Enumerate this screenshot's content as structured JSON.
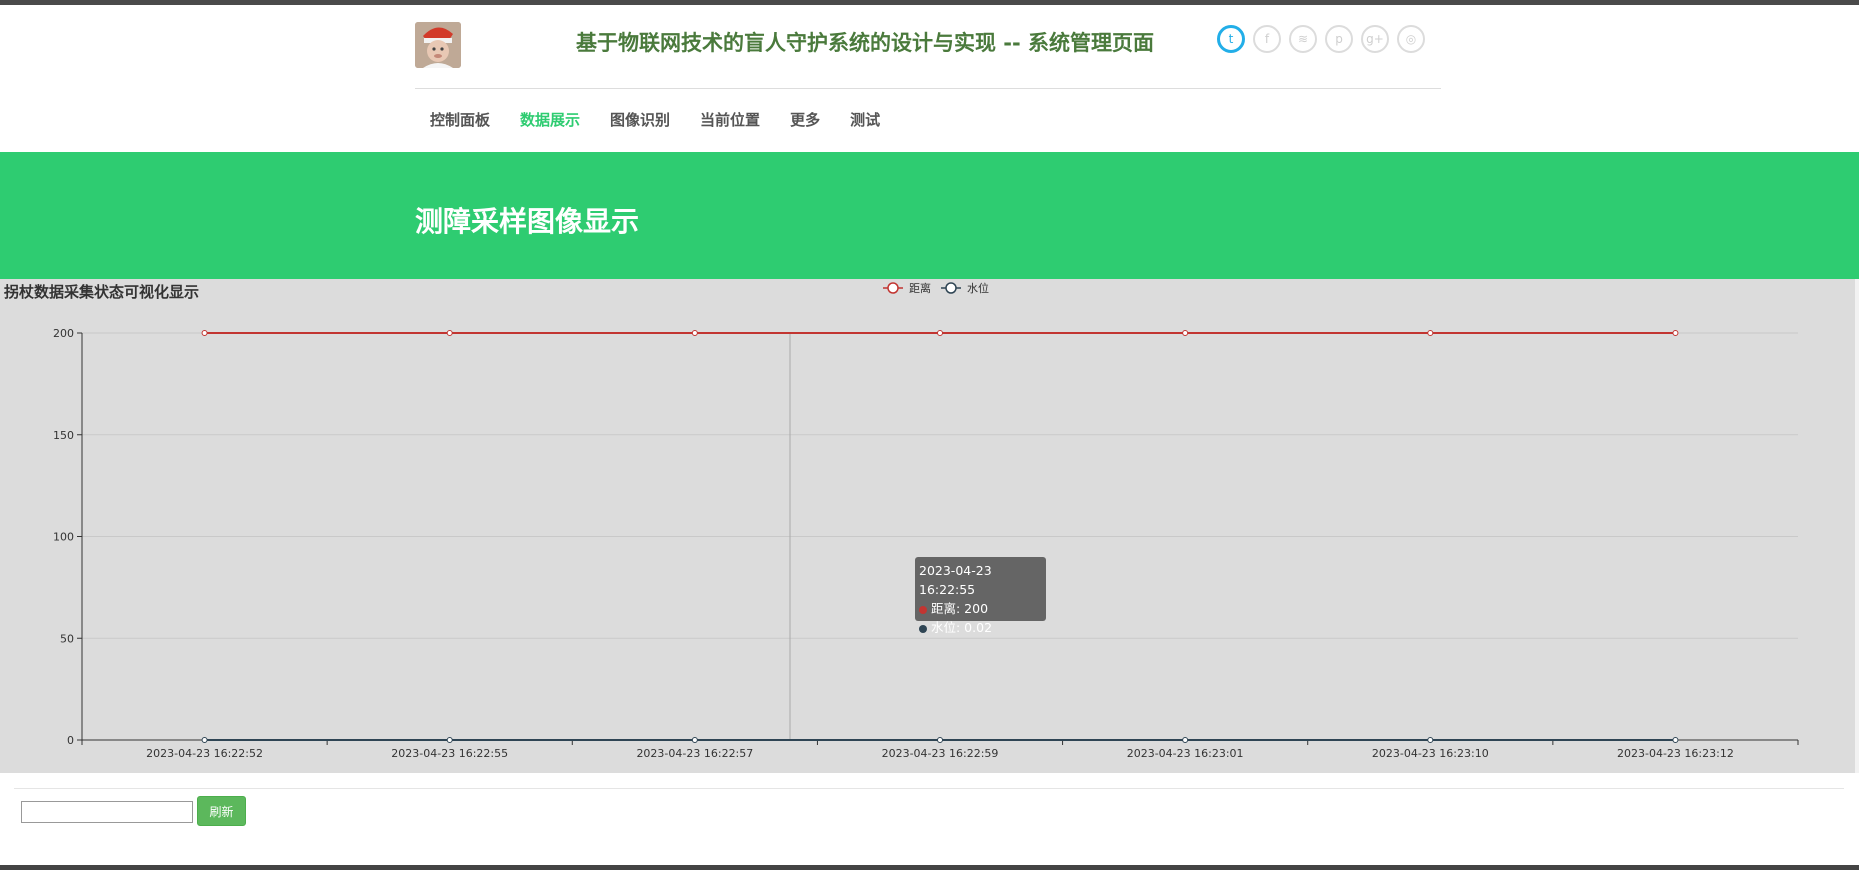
{
  "header": {
    "site_title": "基于物联网技术的盲人守护系统的设计与实现 -- 系统管理页面",
    "social_icons": [
      "twitter-icon",
      "facebook-icon",
      "rss-icon",
      "pinterest-icon",
      "google-plus-icon",
      "dribbble-icon"
    ],
    "social_glyphs": [
      "t",
      "f",
      "≋",
      "p",
      "g+",
      "◎"
    ]
  },
  "nav": {
    "items": [
      "控制面板",
      "数据展示",
      "图像识别",
      "当前位置",
      "更多",
      "测试"
    ],
    "active_index": 1
  },
  "banner": {
    "title": "测障采样图像显示"
  },
  "chart": {
    "title": "拐杖数据采集状态可视化显示"
  },
  "chart_data": {
    "type": "line",
    "title": "拐杖数据采集状态可视化显示",
    "categories": [
      "2023-04-23 16:22:52",
      "2023-04-23 16:22:55",
      "2023-04-23 16:22:57",
      "2023-04-23 16:22:59",
      "2023-04-23 16:23:01",
      "2023-04-23 16:23:10",
      "2023-04-23 16:23:12"
    ],
    "series": [
      {
        "name": "距离",
        "values": [
          200,
          200,
          200,
          200,
          200,
          200,
          200
        ],
        "color": "#c23531"
      },
      {
        "name": "水位",
        "values": [
          0.02,
          0.02,
          0.02,
          0.02,
          0.02,
          0.02,
          0.02
        ],
        "color": "#2f4554"
      }
    ],
    "ylim": [
      0,
      200
    ],
    "yticks": [
      0,
      50,
      100,
      150,
      200
    ],
    "legend_position": "top-center",
    "grid": true
  },
  "tooltip": {
    "time": "2023-04-23 16:22:55",
    "line1": "距离: 200",
    "line2": "水位: 0.02"
  },
  "controls": {
    "refresh_label": "刷新",
    "input_value": ""
  },
  "colors": {
    "accent": "#2ecc71",
    "title_green": "#4a7a3c",
    "twitter_blue": "#22aee8",
    "refresh_button": "#5cb85c"
  }
}
